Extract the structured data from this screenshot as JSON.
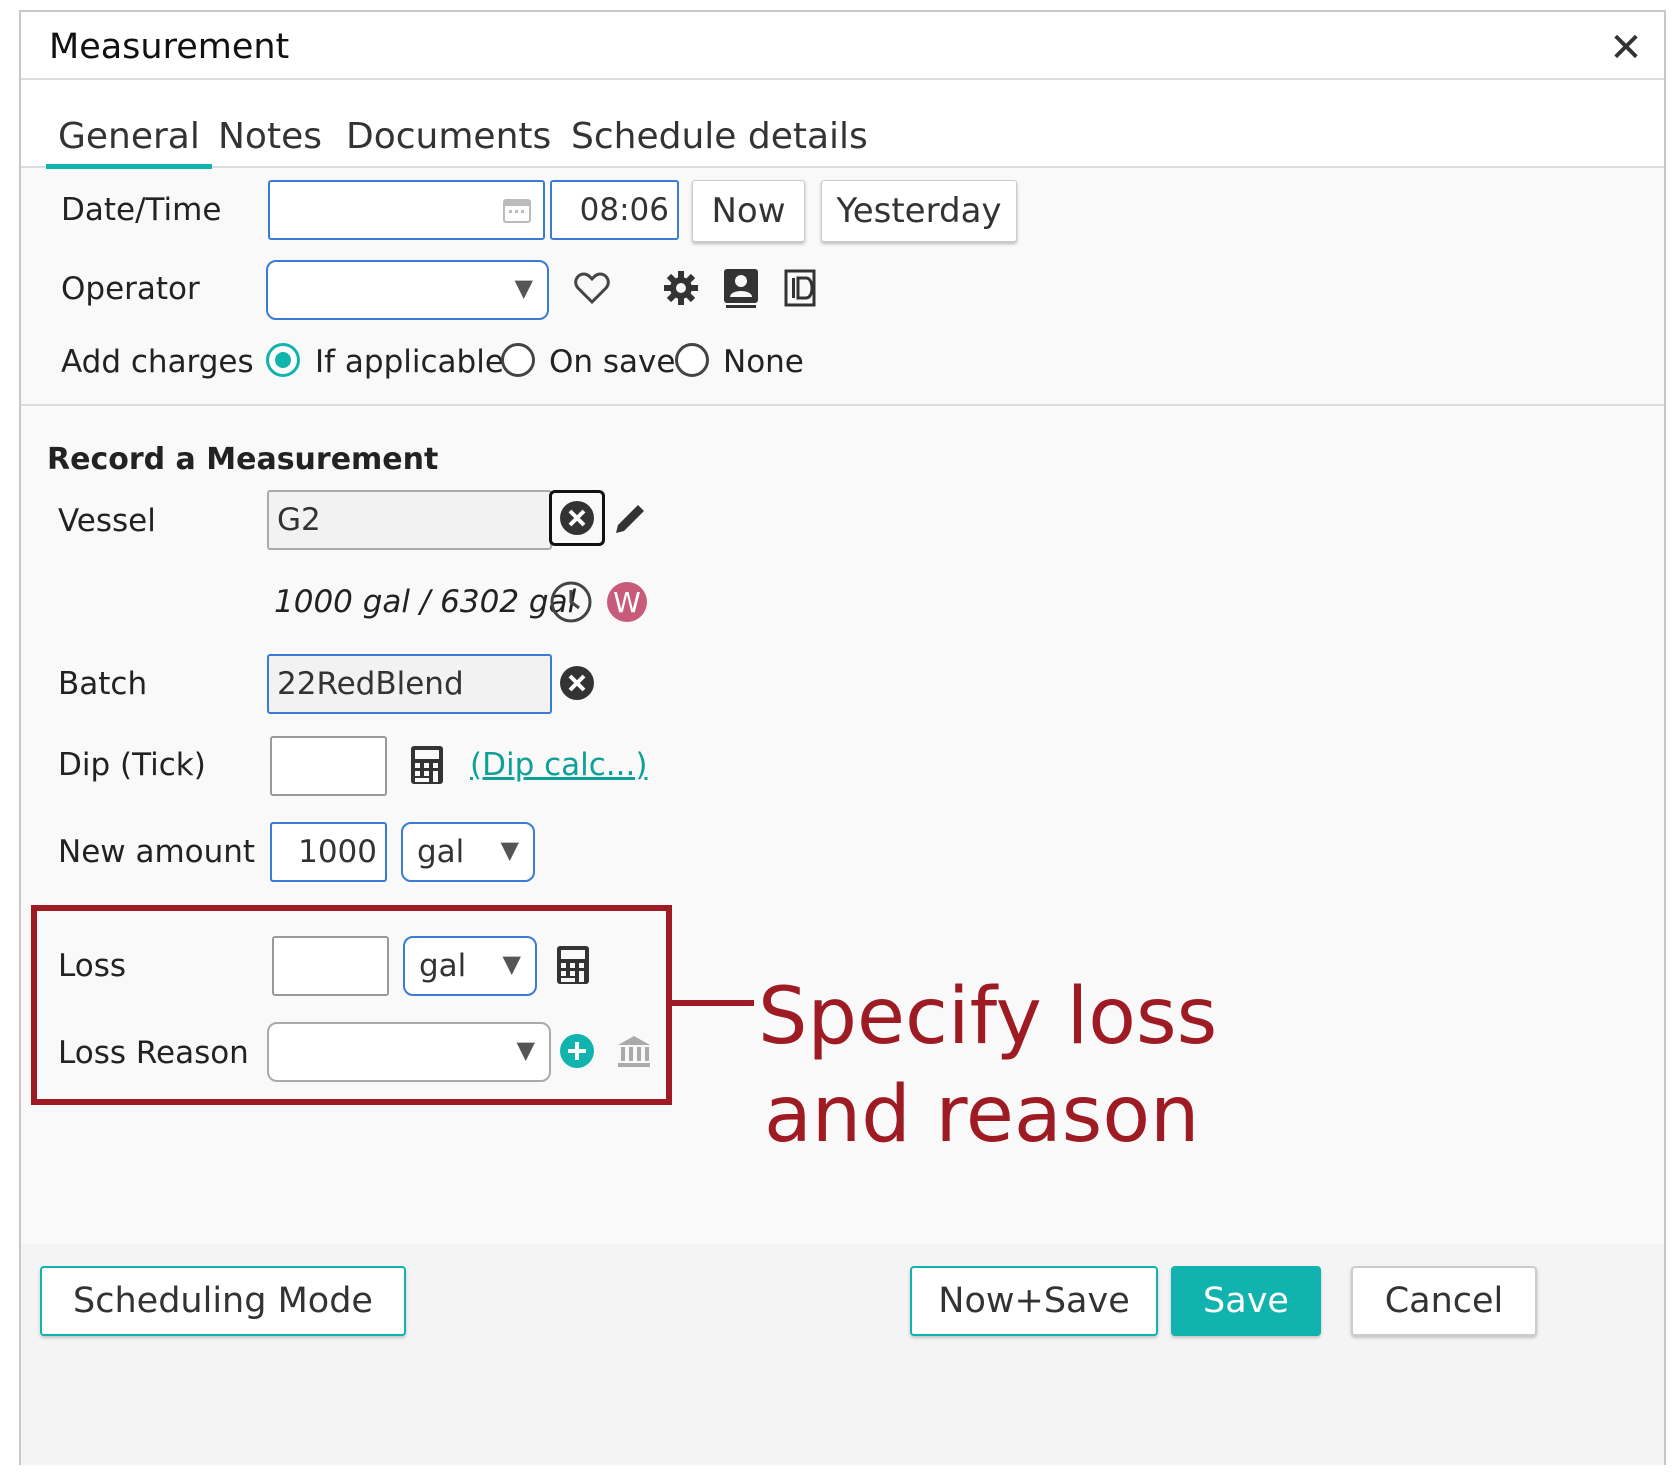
{
  "dialog": {
    "title": "Measurement",
    "close_symbol": "✕"
  },
  "tabs": [
    {
      "label": "General",
      "active": true
    },
    {
      "label": "Notes",
      "active": false
    },
    {
      "label": "Documents",
      "active": false
    },
    {
      "label": "Schedule details",
      "active": false
    }
  ],
  "general": {
    "datetime_label": "Date/Time",
    "date_value": "",
    "time_value": "08:06",
    "now_label": "Now",
    "yesterday_label": "Yesterday",
    "operator_label": "Operator",
    "operator_value": "",
    "add_charges_label": "Add charges",
    "charges_options": [
      "If applicable",
      "On save",
      "None"
    ],
    "charges_selected": "If applicable"
  },
  "record": {
    "heading": "Record a Measurement",
    "vessel_label": "Vessel",
    "vessel_value": "G2",
    "capacity_text": "1000 gal / 6302 gal",
    "vessel_badge": "W",
    "batch_label": "Batch",
    "batch_value": "22RedBlend",
    "dip_label": "Dip (Tick)",
    "dip_value": "",
    "dip_calc_link": "(Dip calc...)",
    "new_amount_label": "New amount",
    "new_amount_value": "1000",
    "new_amount_unit": "gal",
    "loss_label": "Loss",
    "loss_value": "",
    "loss_unit": "gal",
    "loss_reason_label": "Loss Reason",
    "loss_reason_value": ""
  },
  "footer": {
    "scheduling_mode": "Scheduling Mode",
    "now_save": "Now+Save",
    "save": "Save",
    "cancel": "Cancel"
  },
  "annotation": {
    "text_line1": "Specify loss",
    "text_line2": "and reason"
  },
  "colors": {
    "accent": "#10b3ad",
    "annotation": "#9e1b24",
    "badge": "#c85a7a"
  },
  "icons": [
    "calendar-icon",
    "heart-icon",
    "gear-icon",
    "contact-card-icon",
    "document-id-icon",
    "clear-icon",
    "edit-pencil-icon",
    "clock-icon",
    "calculator-icon",
    "add-circle-icon",
    "bank-icon",
    "close-icon"
  ]
}
